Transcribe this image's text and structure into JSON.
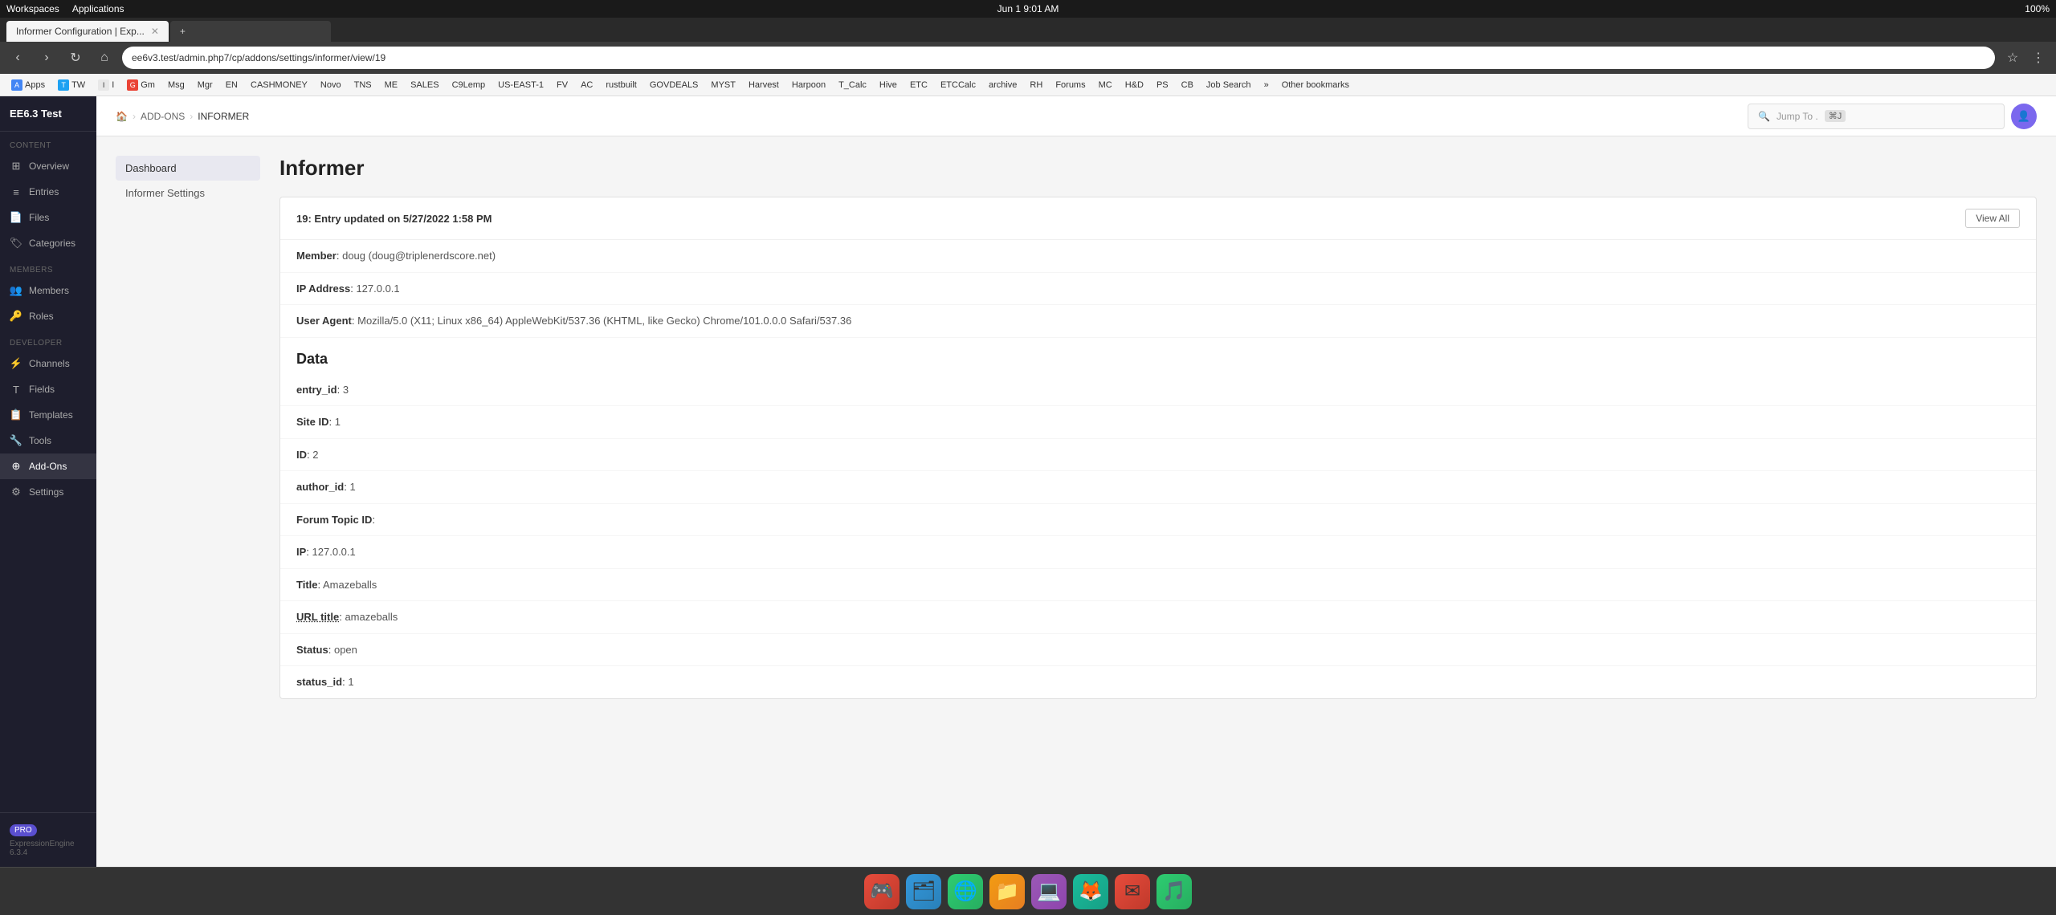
{
  "os": {
    "top_bar": {
      "left": [
        "Workspaces",
        "Applications"
      ],
      "center": "Jun 1   9:01 AM",
      "right": "100%"
    }
  },
  "browser": {
    "tabs": [
      {
        "id": 1,
        "label": "Informer Configuration | Exp...",
        "active": true
      },
      {
        "id": 2,
        "label": "+",
        "active": false
      }
    ],
    "address": "ee6v3.test/admin.php7/cp/addons/settings/informer/view/19",
    "bookmarks": [
      {
        "label": "Apps",
        "color": "#4285F4"
      },
      {
        "label": "TW",
        "color": "#1DA1F2"
      },
      {
        "label": "I",
        "color": "#e8e8e8"
      },
      {
        "label": "Gm",
        "color": "#EA4335"
      },
      {
        "label": "Msg",
        "color": "#0084FF"
      },
      {
        "label": "Mgr",
        "color": "#4285F4"
      },
      {
        "label": "EN",
        "color": "#00C853"
      },
      {
        "label": "CASHMONEY",
        "color": "#666"
      },
      {
        "label": "Novo",
        "color": "#00BCD4"
      },
      {
        "label": "TNS",
        "color": "#3F51B5"
      },
      {
        "label": "ME",
        "color": "#9C27B0"
      },
      {
        "label": "SALES",
        "color": "#F44336"
      },
      {
        "label": "C9Lemp",
        "color": "#FF9800"
      },
      {
        "label": "US-EAST-1",
        "color": "#FF9800"
      },
      {
        "label": "FV",
        "color": "#4CAF50"
      },
      {
        "label": "AC",
        "color": "#2196F3"
      },
      {
        "label": "rustbuilt",
        "color": "#795548"
      },
      {
        "label": "GOVDEALS",
        "color": "#3F51B5"
      },
      {
        "label": "MYST",
        "color": "#9C27B0"
      },
      {
        "label": "Harvest",
        "color": "#F44336"
      },
      {
        "label": "Harpoon",
        "color": "#FF9800"
      },
      {
        "label": "T_Calc",
        "color": "#4CAF50"
      },
      {
        "label": "Hive",
        "color": "#FFC107"
      },
      {
        "label": "ETC",
        "color": "#607D8B"
      },
      {
        "label": "ETCCalc",
        "color": "#607D8B"
      },
      {
        "label": "archive",
        "color": "#795548"
      },
      {
        "label": "RH",
        "color": "#E91E63"
      },
      {
        "label": "Forums",
        "color": "#3F51B5"
      },
      {
        "label": "MC",
        "color": "#4CAF50"
      },
      {
        "label": "H&D",
        "color": "#FF5722"
      },
      {
        "label": "PS",
        "color": "#2196F3"
      },
      {
        "label": "CB",
        "color": "#9E9E9E"
      },
      {
        "label": "Job Search",
        "color": "#4285F4"
      },
      {
        "label": "»",
        "color": "#666"
      },
      {
        "label": "Other bookmarks",
        "color": "#666"
      }
    ]
  },
  "cms": {
    "site_title": "EE6.3 Test",
    "breadcrumb": {
      "home_icon": "🏠",
      "items": [
        "ADD-ONS",
        "INFORMER"
      ]
    },
    "jump_to": {
      "placeholder": "Jump To .",
      "kbd": "⌘J"
    },
    "sidebar": {
      "logo": "EE6.3 Test",
      "sections": [
        {
          "label": "CONTENT",
          "items": [
            {
              "id": "overview",
              "label": "Overview",
              "icon": "⊞"
            },
            {
              "id": "entries",
              "label": "Entries",
              "icon": "≡"
            },
            {
              "id": "files",
              "label": "Files",
              "icon": "📄"
            },
            {
              "id": "categories",
              "label": "Categories",
              "icon": "🏷"
            }
          ]
        },
        {
          "label": "MEMBERS",
          "items": [
            {
              "id": "members",
              "label": "Members",
              "icon": "👥"
            },
            {
              "id": "roles",
              "label": "Roles",
              "icon": "🔑"
            }
          ]
        },
        {
          "label": "DEVELOPER",
          "items": [
            {
              "id": "channels",
              "label": "Channels",
              "icon": "⚡"
            },
            {
              "id": "fields",
              "label": "Fields",
              "icon": "T"
            },
            {
              "id": "templates",
              "label": "Templates",
              "icon": "📋"
            },
            {
              "id": "tools",
              "label": "Tools",
              "icon": "🔧"
            },
            {
              "id": "addons",
              "label": "Add-Ons",
              "icon": "⊕",
              "active": true
            },
            {
              "id": "settings",
              "label": "Settings",
              "icon": "⚙"
            }
          ]
        }
      ],
      "footer": {
        "badge": "PRO",
        "version": "ExpressionEngine 6.3.4"
      }
    },
    "sub_nav": {
      "items": [
        {
          "id": "dashboard",
          "label": "Dashboard"
        },
        {
          "id": "settings",
          "label": "Informer Settings"
        }
      ]
    },
    "page": {
      "title": "Informer",
      "entry": {
        "header": "19: Entry updated on 5/27/2022 1:58 PM",
        "view_all_label": "View All",
        "fields": [
          {
            "label": "Member",
            "value": "doug (doug@triplenerdscore.net)"
          },
          {
            "label": "IP Address",
            "value": "127.0.0.1"
          },
          {
            "label": "User Agent",
            "value": "Mozilla/5.0 (X11; Linux x86_64) AppleWebKit/537.36 (KHTML, like Gecko) Chrome/101.0.0.0 Safari/537.36"
          }
        ]
      },
      "data_section": {
        "title": "Data",
        "fields": [
          {
            "label": "entry_id",
            "value": "3"
          },
          {
            "label": "Site ID",
            "value": "1"
          },
          {
            "label": "ID",
            "value": "2"
          },
          {
            "label": "author_id",
            "value": "1"
          },
          {
            "label": "Forum Topic ID",
            "value": ""
          },
          {
            "label": "IP",
            "value": "127.0.0.1"
          },
          {
            "label": "Title",
            "value": "Amazeballs"
          },
          {
            "label": "URL title",
            "value": "amazeballs"
          },
          {
            "label": "Status",
            "value": "open"
          },
          {
            "label": "status_id",
            "value": "1"
          }
        ]
      }
    }
  },
  "taskbar": {
    "icons": [
      "🎮",
      "🗂",
      "🌐",
      "📁",
      "💻",
      "🦊",
      "✉",
      "🎵"
    ]
  }
}
